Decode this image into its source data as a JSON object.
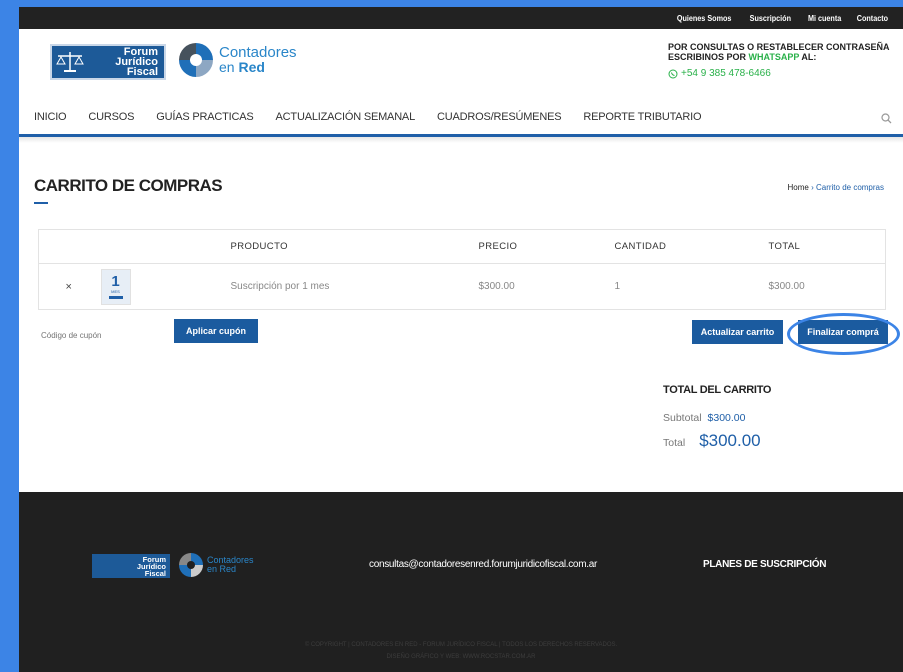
{
  "topbar": {
    "links": [
      "Quienes Somos",
      "Suscripción",
      "Mi cuenta",
      "Contacto"
    ]
  },
  "header": {
    "logo_forum": "Forum Jurídico Fiscal",
    "logo_forum_lines": [
      "Forum",
      "Jurídico",
      "Fiscal"
    ],
    "logo_cer_line1": "Contadores",
    "logo_cer_line2a": "en",
    "logo_cer_line2b": "Red",
    "contact_line1": "POR CONSULTAS O RESTABLECER CONTRASEÑA",
    "contact_line2_pre": "ESCRIBINOS POR ",
    "contact_line2_wa": "WHATSAPP",
    "contact_line2_post": " AL:",
    "phone": "+54 9 385 478-6466"
  },
  "nav": {
    "items": [
      "INICIO",
      "CURSOS",
      "GUÍAS PRACTICAS",
      "ACTUALIZACIÓN SEMANAL",
      "CUADROS/RESÚMENES",
      "REPORTE TRIBUTARIO"
    ],
    "search_icon": "search-icon"
  },
  "page": {
    "title": "CARRITO DE COMPRAS",
    "breadcrumb_home": "Home",
    "breadcrumb_sep": " › ",
    "breadcrumb_current": "Carrito de compras"
  },
  "cart": {
    "headers": {
      "product": "PRODUCTO",
      "price": "PRECIO",
      "quantity": "CANTIDAD",
      "total": "TOTAL"
    },
    "rows": [
      {
        "remove": "×",
        "thumb_number": "1",
        "thumb_label": "MES",
        "product": "Suscripción por 1 mes",
        "price": "$300.00",
        "quantity": "1",
        "total": "$300.00"
      }
    ]
  },
  "actions": {
    "coupon_placeholder": "Código de cupón",
    "apply_coupon": "Aplicar cupón",
    "update_cart": "Actualizar carrito",
    "checkout": "Finalizar comprá"
  },
  "totals": {
    "title": "TOTAL DEL CARRITO",
    "subtotal_label": "Subtotal",
    "subtotal_value": "$300.00",
    "total_label": "Total",
    "total_value": "$300.00"
  },
  "footer": {
    "email": "consultas@contadoresenred.forumjuridicofiscal.com.ar",
    "plans": "PLANES DE SUSCRIPCIÓN",
    "logo_forum_lines": [
      "Forum",
      "Jurídico",
      "Fiscal"
    ],
    "logo_cer_line1": "Contadores",
    "logo_cer_line2": "en Red",
    "copyright": "© COPYRIGHT | CONTADORES EN RED - FORUM JURÍDICO FISCAL | TODOS LOS DERECHOS RESERVADOS.",
    "design": "DISEÑO GRÁFICO Y WEB: WWW.ROCSTAR.COM.AR"
  },
  "colors": {
    "brand_blue": "#1b5b9f",
    "whatsapp_green": "#2ab14a",
    "highlight_circle": "#3c84e6",
    "footer_bg": "#202020"
  }
}
